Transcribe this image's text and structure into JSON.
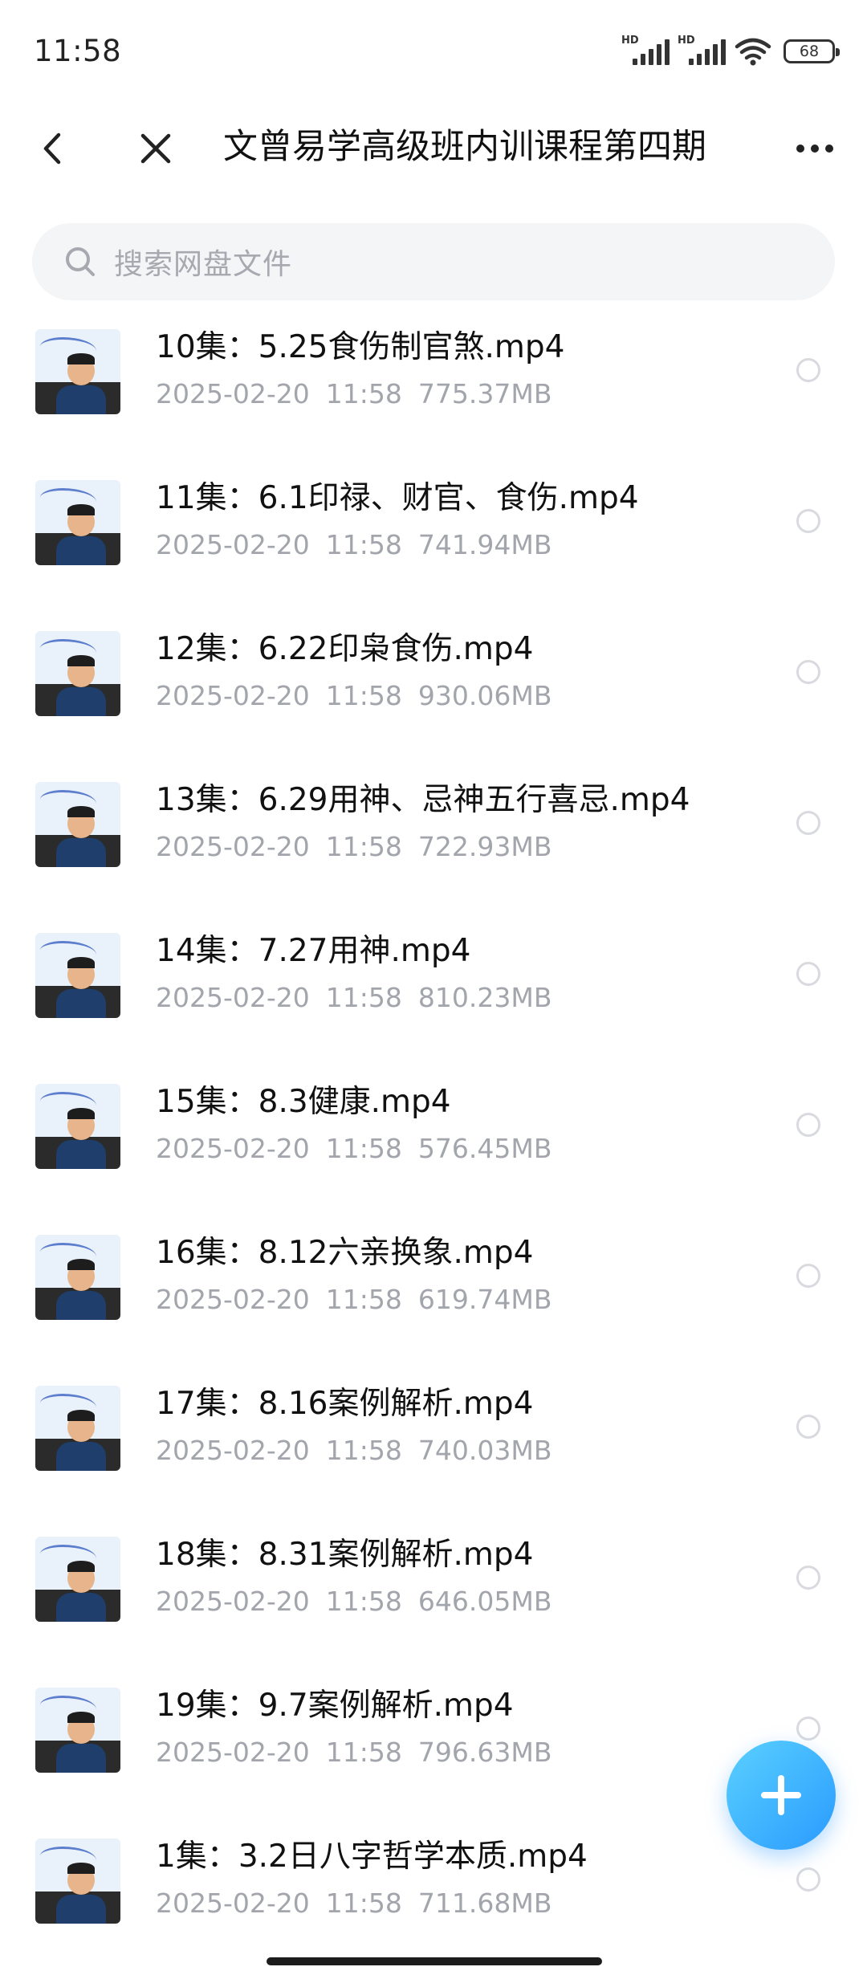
{
  "status_bar": {
    "time": "11:58",
    "signal1_label": "HD",
    "signal2_label": "HD",
    "wifi_icon": "wifi-icon",
    "battery_level": "68"
  },
  "header": {
    "back_icon": "back-arrow-icon",
    "close_icon": "close-icon",
    "title": "文曾易学高级班内训课程第四期",
    "more_icon": "more-dots-icon"
  },
  "search": {
    "placeholder": "搜索网盘文件",
    "icon": "search-icon"
  },
  "files": [
    {
      "name": "10集：5.25食伤制官煞.mp4",
      "date": "2025-02-20",
      "time": "11:58",
      "size": "775.37MB"
    },
    {
      "name": "11集：6.1印禄、财官、食伤.mp4",
      "date": "2025-02-20",
      "time": "11:58",
      "size": "741.94MB"
    },
    {
      "name": "12集：6.22印枭食伤.mp4",
      "date": "2025-02-20",
      "time": "11:58",
      "size": "930.06MB"
    },
    {
      "name": "13集：6.29用神、忌神五行喜忌.mp4",
      "date": "2025-02-20",
      "time": "11:58",
      "size": "722.93MB"
    },
    {
      "name": "14集：7.27用神.mp4",
      "date": "2025-02-20",
      "time": "11:58",
      "size": "810.23MB"
    },
    {
      "name": "15集：8.3健康.mp4",
      "date": "2025-02-20",
      "time": "11:58",
      "size": "576.45MB"
    },
    {
      "name": "16集：8.12六亲换象.mp4",
      "date": "2025-02-20",
      "time": "11:58",
      "size": "619.74MB"
    },
    {
      "name": "17集：8.16案例解析.mp4",
      "date": "2025-02-20",
      "time": "11:58",
      "size": "740.03MB"
    },
    {
      "name": "18集：8.31案例解析.mp4",
      "date": "2025-02-20",
      "time": "11:58",
      "size": "646.05MB"
    },
    {
      "name": "19集：9.7案例解析.mp4",
      "date": "2025-02-20",
      "time": "11:58",
      "size": "796.63MB"
    },
    {
      "name": "1集：3.2日八字哲学本质.mp4",
      "date": "2025-02-20",
      "time": "11:58",
      "size": "711.68MB"
    }
  ],
  "fab": {
    "icon": "plus-icon"
  },
  "colors": {
    "accent": "#2a9bff",
    "meta_text": "#a2a5ab",
    "search_bg": "#f4f5f7"
  }
}
